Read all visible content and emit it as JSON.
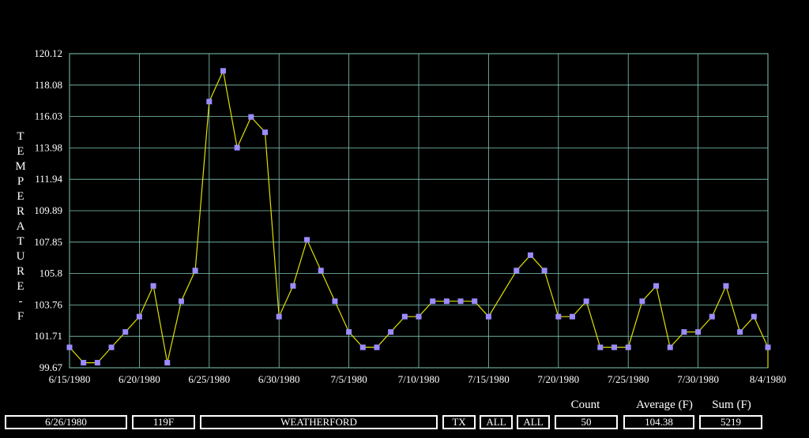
{
  "chart_data": {
    "type": "line",
    "ylabel": "TEMPERATURE - F",
    "ylim": [
      99.67,
      120.12
    ],
    "yticks": [
      "120.12",
      "118.08",
      "116.03",
      "113.98",
      "111.94",
      "109.89",
      "107.85",
      "105.8",
      "103.76",
      "101.71",
      "99.67"
    ],
    "xticks": [
      "6/15/1980",
      "6/20/1980",
      "6/25/1980",
      "6/30/1980",
      "7/5/1980",
      "7/10/1980",
      "7/15/1980",
      "7/20/1980",
      "7/25/1980",
      "7/30/1980",
      "8/4/1980"
    ],
    "grid": true,
    "colors": {
      "line": "#e0e000",
      "marker": "#9b8cff",
      "grid": "#7fc8b8",
      "background": "#000000"
    },
    "x": [
      "6/15/1980",
      "6/16/1980",
      "6/17/1980",
      "6/18/1980",
      "6/19/1980",
      "6/20/1980",
      "6/21/1980",
      "6/22/1980",
      "6/23/1980",
      "6/24/1980",
      "6/25/1980",
      "6/26/1980",
      "6/27/1980",
      "6/28/1980",
      "6/29/1980",
      "6/30/1980",
      "7/1/1980",
      "7/2/1980",
      "7/3/1980",
      "7/4/1980",
      "7/5/1980",
      "7/6/1980",
      "7/7/1980",
      "7/8/1980",
      "7/9/1980",
      "7/10/1980",
      "7/11/1980",
      "7/12/1980",
      "7/13/1980",
      "7/14/1980",
      "7/15/1980",
      "7/16/1980",
      "7/17/1980",
      "7/18/1980",
      "7/19/1980",
      "7/20/1980",
      "7/21/1980",
      "7/22/1980",
      "7/23/1980",
      "7/24/1980",
      "7/25/1980",
      "7/26/1980",
      "7/27/1980",
      "7/28/1980",
      "7/29/1980",
      "7/30/1980",
      "7/31/1980",
      "8/1/1980",
      "8/2/1980",
      "8/3/1980",
      "8/4/1980"
    ],
    "values": [
      101,
      100,
      100,
      101,
      102,
      103,
      105,
      100,
      104,
      106,
      117,
      119,
      114,
      116,
      115,
      103,
      105,
      108,
      106,
      104,
      102,
      101,
      101,
      102,
      103,
      103,
      104,
      104,
      104,
      104,
      103,
      null,
      106,
      107,
      106,
      103,
      103,
      104,
      101,
      101,
      101,
      104,
      105,
      101,
      102,
      102,
      103,
      105,
      102,
      103,
      101
    ],
    "values_note": null
  },
  "footer": {
    "date": "6/26/1980",
    "temp": "119F",
    "station": "WEATHERFORD",
    "state": "TX",
    "filter1": "ALL",
    "filter2": "ALL",
    "count_label": "Count",
    "count": "50",
    "average_label": "Average (F)",
    "average": "104.38",
    "sum_label": "Sum (F)",
    "sum": "5219"
  }
}
